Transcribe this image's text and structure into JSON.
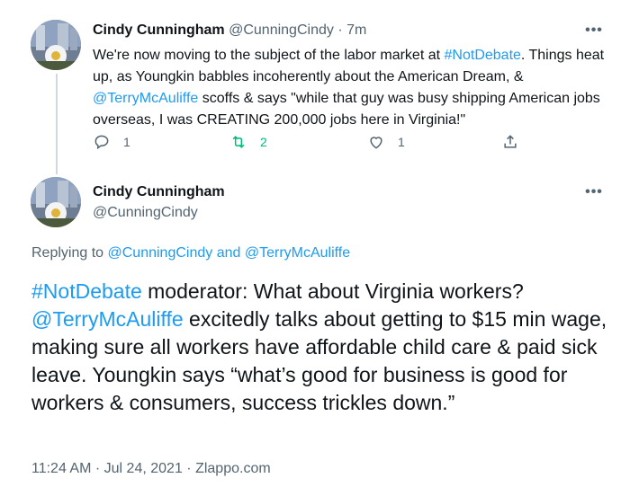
{
  "tweet1": {
    "name": "Cindy Cunningham",
    "handle": "@CunningCindy",
    "time": "7m",
    "separator": "·",
    "more_icon": "more-dots-icon",
    "more_label": "•••",
    "text_parts": [
      {
        "t": "We're now moving to the subject of the labor market at ",
        "link": false
      },
      {
        "t": "#NotDebate",
        "link": true
      },
      {
        "t": ". Things heat up, as Youngkin babbles incoherently about the American Dream, & ",
        "link": false
      },
      {
        "t": "@TerryMcAuliffe",
        "link": true
      },
      {
        "t": " scoffs & says \"while that guy was busy shipping American jobs overseas, I was CREATING 200,000 jobs here in Virginia!\"",
        "link": false
      }
    ],
    "reply_count": "1",
    "retweet_count": "2",
    "like_count": "1"
  },
  "tweet2": {
    "name": "Cindy Cunningham",
    "handle": "@CunningCindy",
    "more_label": "•••",
    "replying_prefix": "Replying to ",
    "replying_to": [
      "@CunningCindy",
      "@TerryMcAuliffe"
    ],
    "replying_and": " and ",
    "text_parts": [
      {
        "t": "#NotDebate",
        "link": true
      },
      {
        "t": " moderator: What about Virginia workers? ",
        "link": false
      },
      {
        "t": "@TerryMcAuliffe",
        "link": true
      },
      {
        "t": " excitedly talks about getting to $15 min wage, making sure all workers have affordable child care & paid sick leave. Youngkin says “what’s good for business is good for workers & consumers, success trickles down.”",
        "link": false
      }
    ],
    "time": "11:24 AM",
    "date": "Jul 24, 2021",
    "source": "Zlappo.com",
    "meta_sep": "·"
  },
  "colors": {
    "link": "#1d9bf0",
    "secondary": "#536471",
    "retweet": "#00ba7c",
    "thread_line": "#cfd9de"
  }
}
